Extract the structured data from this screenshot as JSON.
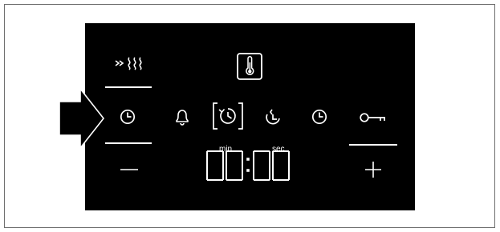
{
  "panel": {
    "background_color": "#000000",
    "foreground_color": "#ffffff"
  },
  "indicator": {
    "icon": "arrow-pointer-icon",
    "points_to": "clock-icon"
  },
  "icons": [
    {
      "name": "rapid-heat-icon"
    },
    {
      "name": "temperature-thermometer-icon"
    },
    {
      "name": "clock-icon"
    },
    {
      "name": "alarm-bell-icon"
    },
    {
      "name": "cooking-time-icon"
    },
    {
      "name": "end-time-icon"
    },
    {
      "name": "time-of-day-icon"
    },
    {
      "name": "child-lock-key-icon"
    },
    {
      "name": "minus-icon"
    },
    {
      "name": "plus-icon"
    }
  ],
  "display": {
    "time": "00:00",
    "label_min": "min",
    "label_sec": "sec"
  }
}
